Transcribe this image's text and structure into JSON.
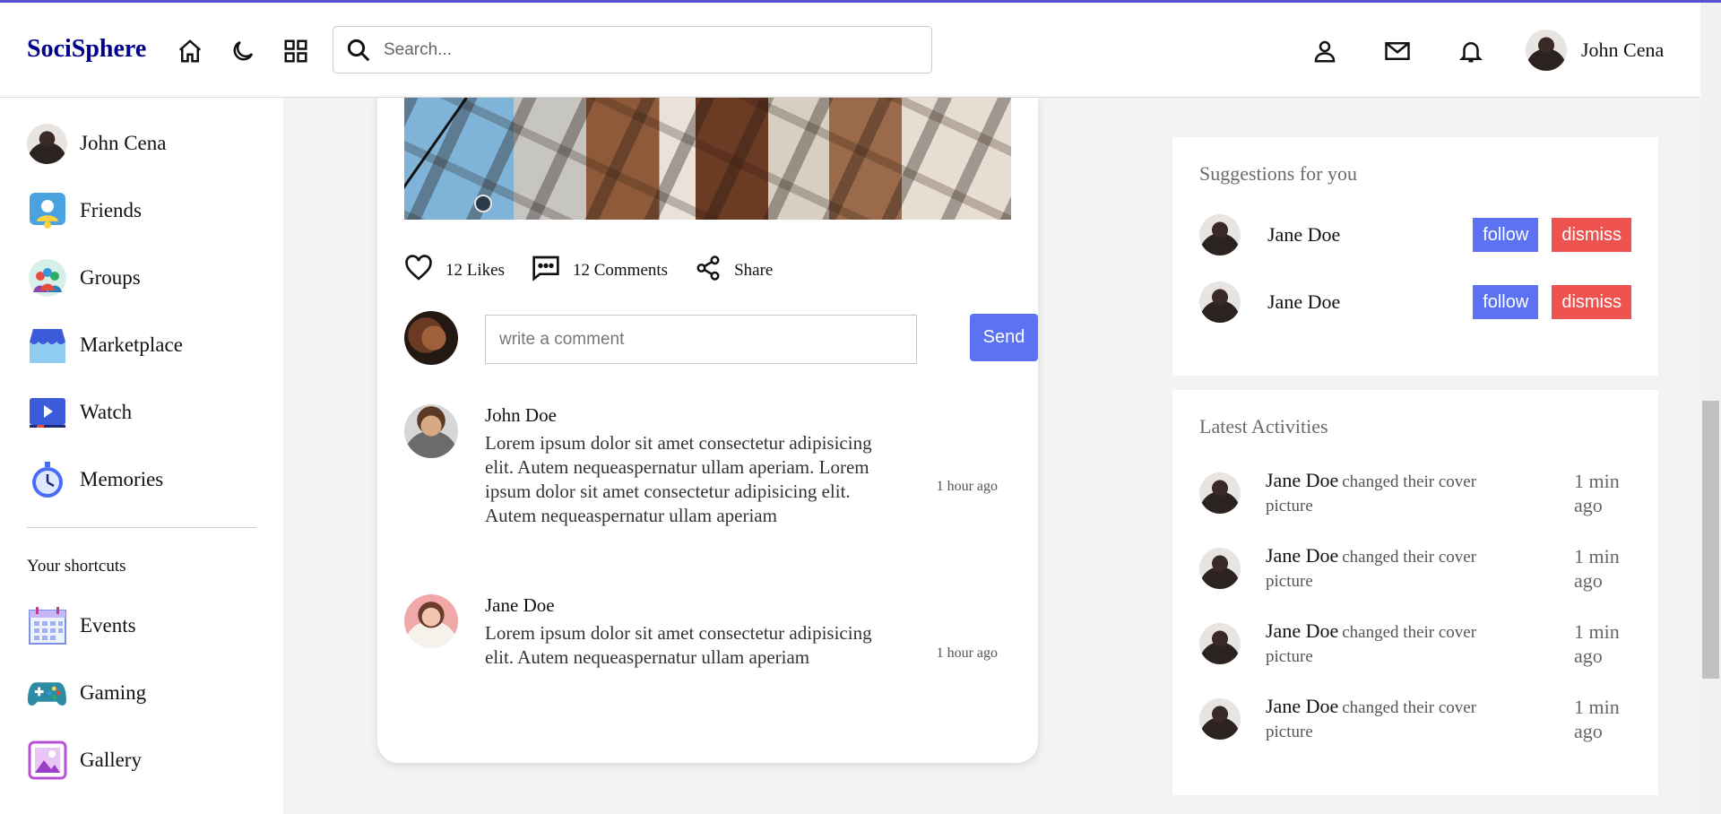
{
  "header": {
    "logo": "SociSphere",
    "search_placeholder": "Search...",
    "user_name": "John Cena"
  },
  "sidebar": {
    "items": [
      {
        "label": "John Cena",
        "icon": "user-avatar"
      },
      {
        "label": "Friends",
        "icon": "friends-icon"
      },
      {
        "label": "Groups",
        "icon": "groups-icon"
      },
      {
        "label": "Marketplace",
        "icon": "marketplace-icon"
      },
      {
        "label": "Watch",
        "icon": "watch-icon"
      },
      {
        "label": "Memories",
        "icon": "memories-icon"
      }
    ],
    "shortcuts_title": "Your shortcuts",
    "shortcuts": [
      {
        "label": "Events",
        "icon": "calendar-icon"
      },
      {
        "label": "Gaming",
        "icon": "gamepad-icon"
      },
      {
        "label": "Gallery",
        "icon": "gallery-icon"
      }
    ]
  },
  "post": {
    "likes": "12 Likes",
    "comments": "12 Comments",
    "share": "Share",
    "comment_placeholder": "write a comment",
    "send_label": "Send",
    "comment_list": [
      {
        "author": "John Doe",
        "text": "Lorem ipsum dolor sit amet consectetur adipisicing elit. Autem nequeaspernatur ullam aperiam. Lorem ipsum dolor sit amet consectetur adipisicing elit. Autem nequeaspernatur ullam aperiam",
        "time": "1 hour ago"
      },
      {
        "author": "Jane Doe",
        "text": "Lorem ipsum dolor sit amet consectetur adipisicing elit. Autem nequeaspernatur ullam aperiam",
        "time": "1 hour ago"
      }
    ]
  },
  "suggestions": {
    "title": "Suggestions for you",
    "follow_label": "follow",
    "dismiss_label": "dismiss",
    "users": [
      {
        "name": "Jane Doe"
      },
      {
        "name": "Jane Doe"
      }
    ]
  },
  "activities": {
    "title": "Latest Activities",
    "items": [
      {
        "name": "Jane Doe",
        "action": "changed their cover picture",
        "time": "1 min ago"
      },
      {
        "name": "Jane Doe",
        "action": "changed their cover picture",
        "time": "1 min ago"
      },
      {
        "name": "Jane Doe",
        "action": "changed their cover picture",
        "time": "1 min ago"
      },
      {
        "name": "Jane Doe",
        "action": "changed their cover picture",
        "time": "1 min ago"
      }
    ]
  },
  "colors": {
    "brand": "#00008b",
    "accent": "#5b73f2",
    "danger": "#ef5350"
  }
}
